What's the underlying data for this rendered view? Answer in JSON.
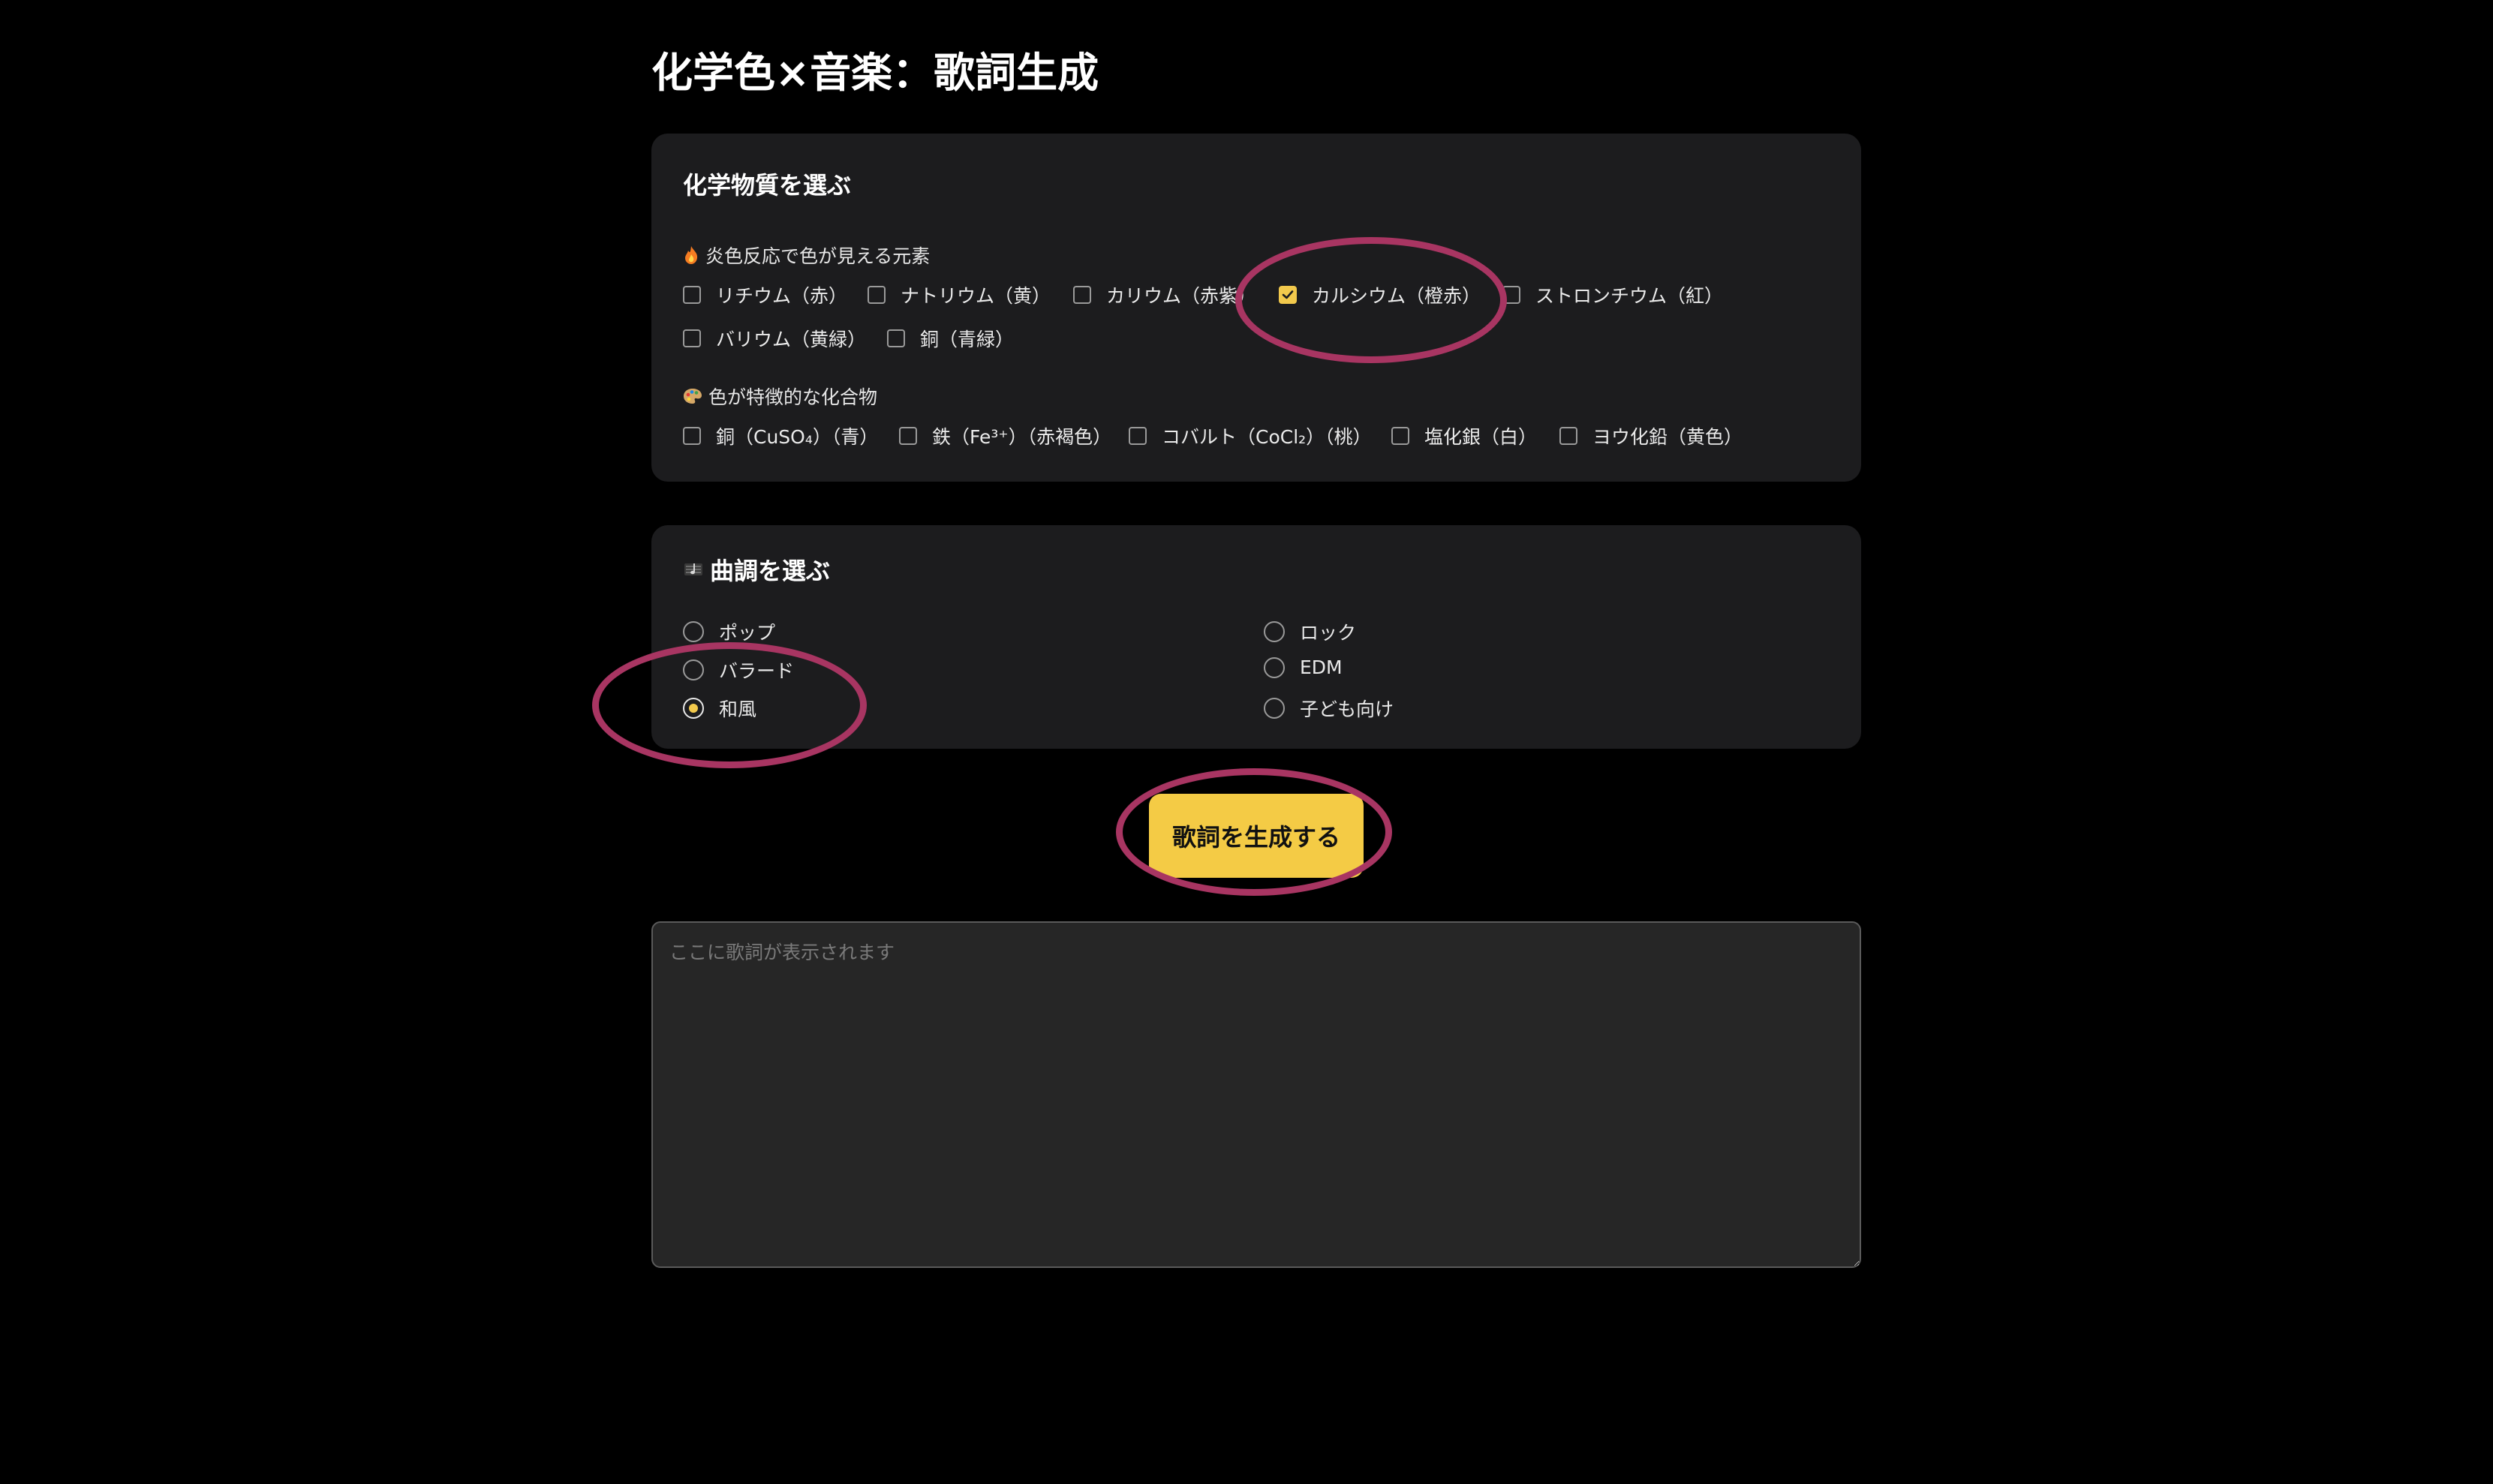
{
  "page": {
    "title": "化学色×音楽：歌詞生成"
  },
  "chemicals": {
    "heading": "化学物質を選ぶ",
    "flame": {
      "label": "炎色反応で色が見える元素",
      "items": [
        {
          "label": "リチウム（赤）",
          "checked": false
        },
        {
          "label": "ナトリウム（黄）",
          "checked": false
        },
        {
          "label": "カリウム（赤紫）",
          "checked": false
        },
        {
          "label": "カルシウム（橙赤）",
          "checked": true
        },
        {
          "label": "ストロンチウム（紅）",
          "checked": false
        },
        {
          "label": "バリウム（黄緑）",
          "checked": false
        },
        {
          "label": "銅（青緑）",
          "checked": false
        }
      ]
    },
    "compounds": {
      "label": "色が特徴的な化合物",
      "items": [
        {
          "label": "銅（CuSO₄）（青）",
          "checked": false
        },
        {
          "label": "鉄（Fe³⁺）（赤褐色）",
          "checked": false
        },
        {
          "label": "コバルト（CoCl₂）（桃）",
          "checked": false
        },
        {
          "label": "塩化銀（白）",
          "checked": false
        },
        {
          "label": "ヨウ化鉛（黄色）",
          "checked": false
        }
      ]
    }
  },
  "tone": {
    "heading": "曲調を選ぶ",
    "options": [
      {
        "label": "ポップ",
        "selected": false
      },
      {
        "label": "ロック",
        "selected": false
      },
      {
        "label": "バラード",
        "selected": false
      },
      {
        "label": "EDM",
        "selected": false
      },
      {
        "label": "和風",
        "selected": true
      },
      {
        "label": "子ども向け",
        "selected": false
      }
    ]
  },
  "generate_button": {
    "label": "歌詞を生成する"
  },
  "output": {
    "placeholder": "ここに歌詞が表示されます",
    "value": ""
  },
  "icons": {
    "flame": "fire-icon",
    "palette": "palette-icon",
    "music": "music-score-icon",
    "check": "check-icon"
  },
  "colors": {
    "accent": "#f4cb45",
    "background": "#000000",
    "card": "#1c1c1e",
    "annotation": "#a83562"
  }
}
